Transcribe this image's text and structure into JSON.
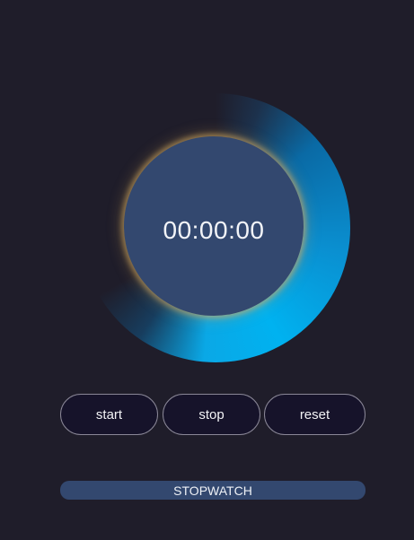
{
  "timer": {
    "display": "00:00:00"
  },
  "controls": {
    "start_label": "start",
    "stop_label": "stop",
    "reset_label": "reset"
  },
  "footer": {
    "title": "STOPWATCH"
  },
  "colors": {
    "background": "#1f1d2a",
    "face": "#33486f",
    "ring_accent": "#00b2f0",
    "glow": "#d4ac62",
    "button_bg": "#16132a",
    "button_border": "#8a8797"
  }
}
